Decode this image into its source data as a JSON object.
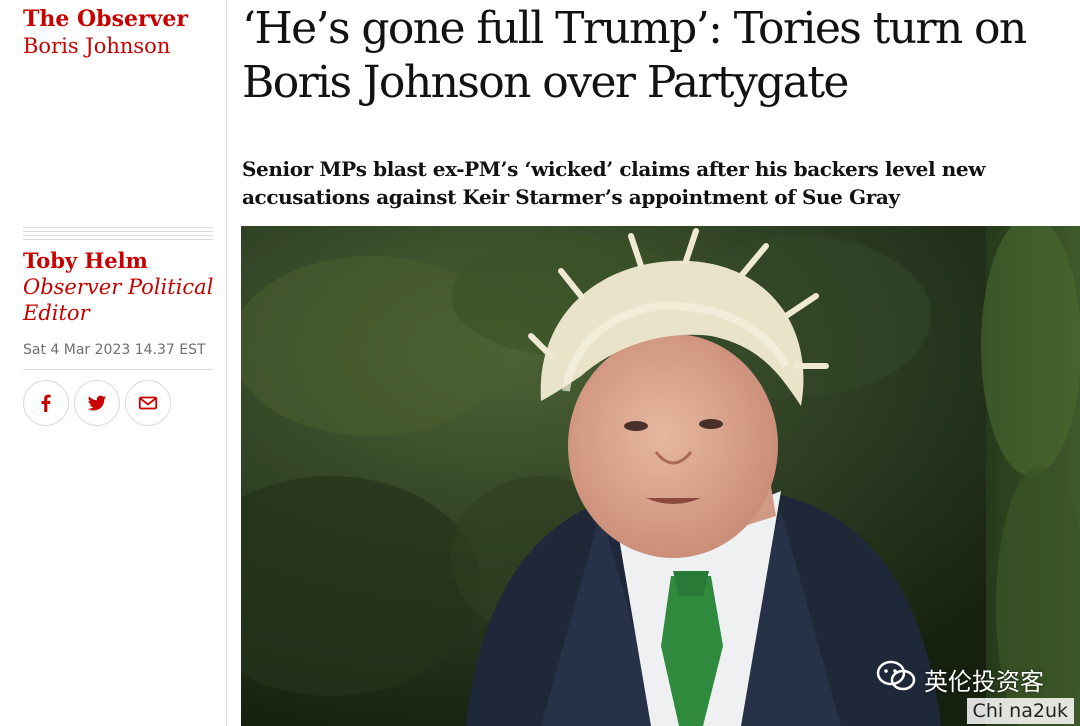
{
  "brand": {
    "name": "The Observer",
    "section": "Boris Johnson"
  },
  "byline": {
    "author": "Toby Helm",
    "role": "Observer Political Editor",
    "date": "Sat 4 Mar 2023 14.37 EST"
  },
  "share": [
    {
      "icon": "facebook-icon",
      "label": "Share on Facebook"
    },
    {
      "icon": "twitter-icon",
      "label": "Share on Twitter"
    },
    {
      "icon": "email-icon",
      "label": "Share via Email"
    }
  ],
  "article": {
    "headline": "‘He’s gone full Trump’: Tories turn on Boris Johnson over Partygate",
    "standfirst": "Senior MPs blast ex-PM’s ‘wicked’ claims after his backers level new accusations against Keir Starmer’s appointment of Sue Gray"
  },
  "watermark": {
    "brand": "英伦投资客",
    "site": "Chi na2uk"
  },
  "colors": {
    "accent": "#c70000",
    "text": "#121212",
    "muted": "#707070",
    "rule": "#dcdcdc"
  }
}
